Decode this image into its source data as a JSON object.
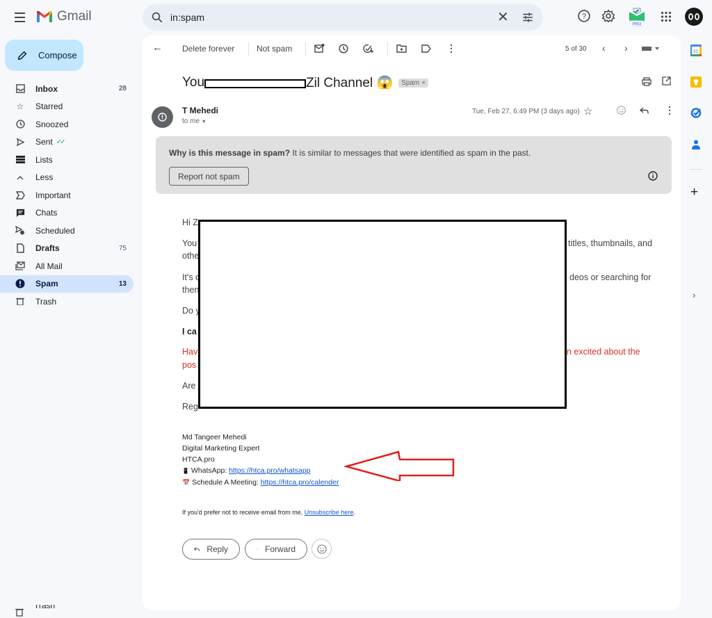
{
  "app": {
    "name": "Gmail"
  },
  "search": {
    "query": "in:spam"
  },
  "compose": {
    "label": "Compose"
  },
  "nav": {
    "items": [
      {
        "label": "Inbox",
        "count": "28",
        "icon": "inbox-icon",
        "bold": true
      },
      {
        "label": "Starred",
        "count": "",
        "icon": "star-icon"
      },
      {
        "label": "Snoozed",
        "count": "",
        "icon": "clock-icon"
      },
      {
        "label": "Sent",
        "count": "",
        "icon": "send-icon"
      },
      {
        "label": "Lists",
        "count": "",
        "icon": "lists-icon"
      },
      {
        "label": "Less",
        "count": "",
        "icon": "chevron-up-icon"
      },
      {
        "label": "Important",
        "count": "",
        "icon": "important-icon"
      },
      {
        "label": "Chats",
        "count": "",
        "icon": "chat-icon"
      },
      {
        "label": "Scheduled",
        "count": "",
        "icon": "scheduled-icon"
      },
      {
        "label": "Drafts",
        "count": "75",
        "icon": "draft-icon",
        "bold": true
      },
      {
        "label": "All Mail",
        "count": "",
        "icon": "all-mail-icon"
      },
      {
        "label": "Spam",
        "count": "13",
        "icon": "spam-icon",
        "active": true
      },
      {
        "label": "Trash",
        "count": "",
        "icon": "trash-icon"
      }
    ],
    "trash_bottom": "Trash"
  },
  "toolbar": {
    "delete_forever": "Delete forever",
    "not_spam": "Not spam",
    "pagination": "5 of 30"
  },
  "message": {
    "subject_prefix": "You",
    "subject_suffix": "Zil Channel 😱",
    "spam_label": "Spam",
    "sender": "T Mehedi",
    "to": "to me",
    "date": "Tue, Feb 27, 6:49 PM (3 days ago)",
    "spam_notice_bold": "Why is this message in spam?",
    "spam_notice_text": " It is similar to messages that were identified as spam in the past.",
    "report_not_spam": "Report not spam",
    "body": {
      "greeting": "Hi Z",
      "p1_start": "You",
      "p1_end": "titles, thumbnails, and",
      "p1_line2": "othe",
      "p2_start": "It's c",
      "p2_end": "deos or searching for",
      "p2_line2": "then",
      "p3": "Do y",
      "p4_bold": "I ca",
      "p5_start": "Hav",
      "p5_end": "n excited about the",
      "p5_line2": "pos",
      "p6": "Are",
      "p7": "Reg"
    },
    "signature": {
      "name": "Md Tangeer Mehedi",
      "title": "Digital Marketing Expert",
      "company": "HTCA.pro",
      "whatsapp_label": "WhatsApp: ",
      "whatsapp_link": "https://htca.pro/whatsapp",
      "meeting_label": "Schedule A Meeting: ",
      "meeting_link": "https://htca.pro/calender"
    },
    "unsubscribe_text": "If you'd prefer not to receive email from me, ",
    "unsubscribe_link": "Unsubscribe here",
    "unsubscribe_end": "."
  },
  "actions": {
    "reply": "Reply",
    "forward": "Forward"
  },
  "colors": {
    "accent": "#c2e7ff",
    "active_nav": "#d3e3fd",
    "link": "#1155cc",
    "warning_text": "#d93025",
    "spam_box": "#e0e0e0"
  }
}
